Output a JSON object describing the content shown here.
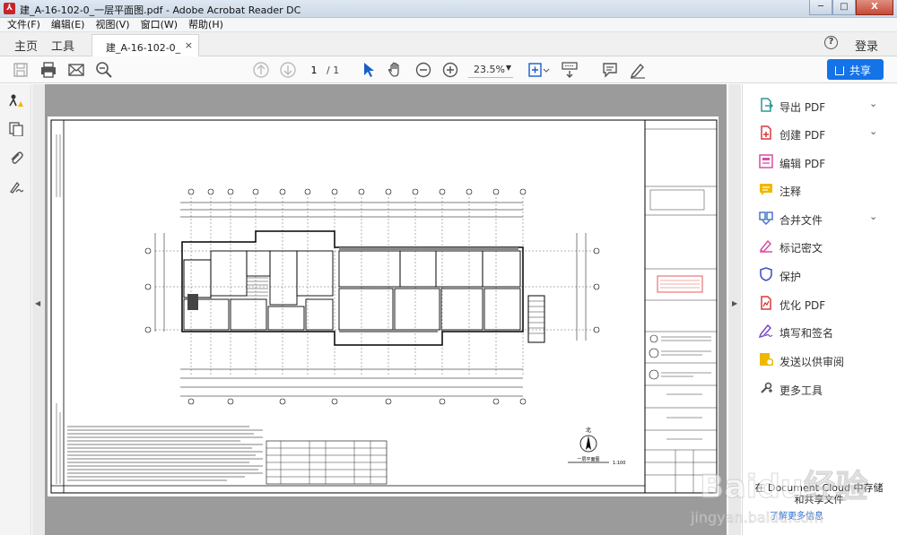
{
  "window": {
    "title": "建_A-16-102-0_一层平面图.pdf - Adobe Acrobat Reader DC",
    "minimize": "─",
    "maximize": "□",
    "close": "X"
  },
  "menu": [
    "文件(F)",
    "编辑(E)",
    "视图(V)",
    "窗口(W)",
    "帮助(H)"
  ],
  "tabs": {
    "home": "主页",
    "tools": "工具",
    "document": "建_A-16-102-0_一…",
    "close": "×"
  },
  "header_right": {
    "help": "?",
    "login": "登录"
  },
  "toolbar": {
    "page_current": "1",
    "page_total": "/ 1",
    "zoom": "23.5%",
    "share_label": "共享"
  },
  "right_panel": {
    "tools": [
      {
        "label": "导出 PDF",
        "icon": "export-pdf-icon",
        "color": "#2c9a8f",
        "expandable": true
      },
      {
        "label": "创建 PDF",
        "icon": "create-pdf-icon",
        "color": "#d9383c",
        "expandable": true
      },
      {
        "label": "编辑 PDF",
        "icon": "edit-pdf-icon",
        "color": "#d84fa2",
        "expandable": false
      },
      {
        "label": "注释",
        "icon": "comment-icon",
        "color": "#f1b800",
        "expandable": false
      },
      {
        "label": "合并文件",
        "icon": "combine-files-icon",
        "color": "#3d6dc8",
        "expandable": true
      },
      {
        "label": "标记密文",
        "icon": "redact-icon",
        "color": "#d84fa2",
        "expandable": false
      },
      {
        "label": "保护",
        "icon": "protect-shield-icon",
        "color": "#4b55c3",
        "expandable": false
      },
      {
        "label": "优化 PDF",
        "icon": "optimize-pdf-icon",
        "color": "#d9383c",
        "expandable": false
      },
      {
        "label": "填写和签名",
        "icon": "fill-sign-icon",
        "color": "#7a4ac8",
        "expandable": false
      },
      {
        "label": "发送以供审阅",
        "icon": "send-review-icon",
        "color": "#f1b800",
        "expandable": false
      },
      {
        "label": "更多工具",
        "icon": "more-tools-icon",
        "color": "#555555",
        "expandable": false
      }
    ],
    "cloud_text": "在 Document Cloud 中存储和共享文件",
    "cloud_link": "了解更多信息"
  },
  "drawing": {
    "north_label": "北",
    "plan_title": "一层平面图",
    "scale": "1:100"
  },
  "watermark": {
    "brand": "Baidu经验",
    "url": "jingyan.baidu.com"
  }
}
